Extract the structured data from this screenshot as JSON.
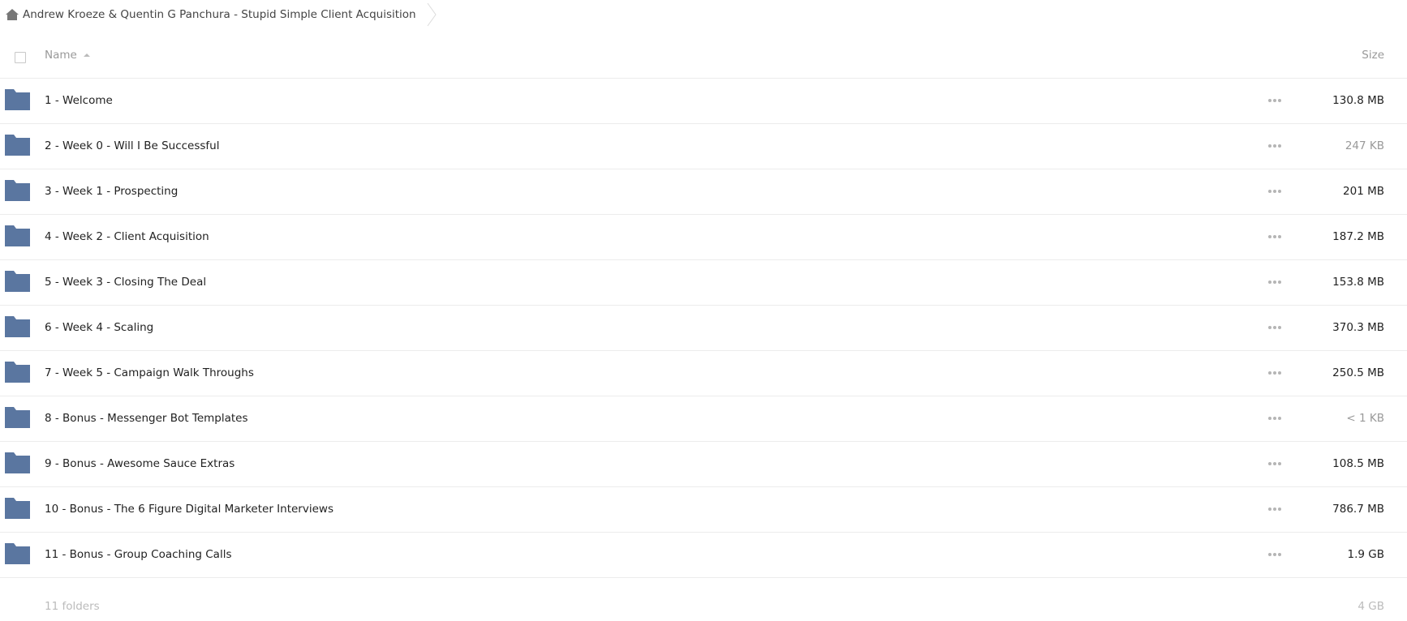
{
  "breadcrumb": {
    "home_icon": "home-icon",
    "current_folder": "Andrew Kroeze & Quentin G Panchura - Stupid Simple Client Acquisition",
    "separator_icon": "chevron-right-icon"
  },
  "table": {
    "columns": {
      "name": "Name",
      "name_sort": "ascending",
      "size": "Size"
    },
    "rows": [
      {
        "name": "1 - Welcome",
        "size": "130.8 MB",
        "muted": false
      },
      {
        "name": "2 - Week 0 - Will I Be Successful",
        "size": "247 KB",
        "muted": true
      },
      {
        "name": "3 - Week 1 - Prospecting",
        "size": "201 MB",
        "muted": false
      },
      {
        "name": "4 - Week 2 - Client Acquisition",
        "size": "187.2 MB",
        "muted": false
      },
      {
        "name": "5 - Week 3 - Closing The Deal",
        "size": "153.8 MB",
        "muted": false
      },
      {
        "name": "6 - Week 4 - Scaling",
        "size": "370.3 MB",
        "muted": false
      },
      {
        "name": "7 - Week 5 - Campaign Walk Throughs",
        "size": "250.5 MB",
        "muted": false
      },
      {
        "name": "8 - Bonus - Messenger Bot Templates",
        "size": "< 1 KB",
        "muted": true
      },
      {
        "name": "9 - Bonus - Awesome Sauce Extras",
        "size": "108.5 MB",
        "muted": false
      },
      {
        "name": "10 - Bonus - The 6 Figure Digital Marketer Interviews",
        "size": "786.7 MB",
        "muted": false
      },
      {
        "name": "11 - Bonus - Group Coaching Calls",
        "size": "1.9 GB",
        "muted": false
      }
    ]
  },
  "footer": {
    "count": "11 folders",
    "total_size": "4 GB"
  },
  "colors": {
    "folder": "#5a76a0",
    "border": "#ececec"
  }
}
